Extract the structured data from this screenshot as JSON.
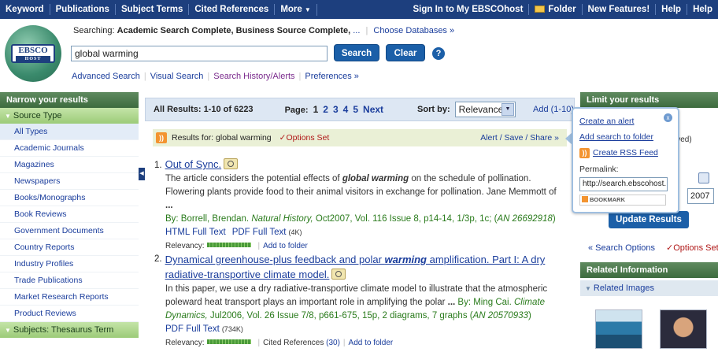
{
  "topnav": {
    "items": [
      "Keyword",
      "Publications",
      "Subject Terms",
      "Cited References",
      "More"
    ],
    "right_items": [
      "Sign In to My EBSCOhost",
      "Folder",
      "New Features!",
      "Help",
      "Help"
    ]
  },
  "logo": {
    "line1": "EBSCO",
    "line2": "HOST"
  },
  "header": {
    "searching_label": "Searching:",
    "databases": "Academic Search Complete, Business Source Complete,",
    "more_link": "...",
    "choose_db": "Choose Databases »",
    "search_value": "global warming",
    "search_btn": "Search",
    "clear_btn": "Clear",
    "help_icon": "?",
    "links": {
      "advanced": "Advanced Search",
      "visual": "Visual Search",
      "history": "Search History/Alerts",
      "prefs": "Preferences »"
    }
  },
  "left": {
    "title": "Narrow your results",
    "source_type": "Source Type",
    "items": [
      "All Types",
      "Academic Journals",
      "Magazines",
      "Newspapers",
      "Books/Monographs",
      "Book Reviews",
      "Government Documents",
      "Country Reports",
      "Industry Profiles",
      "Trade Publications",
      "Market Research Reports",
      "Product Reviews"
    ],
    "subjects": "Subjects: Thesaurus Term"
  },
  "results_bar": {
    "summary": "All Results: 1-10 of 6223",
    "page_label": "Page:",
    "pages": [
      "1",
      "2",
      "3",
      "4",
      "5"
    ],
    "next": "Next",
    "sort_label": "Sort by:",
    "sort_value": "Relevance",
    "add": "Add (1-10)"
  },
  "rss_bar": {
    "results_for": "Results for: global warming",
    "options_set": "✓Options Set",
    "alert": "Alert / Save / Share »"
  },
  "results": [
    {
      "num": "1.",
      "title": "Out of Sync.",
      "abstract_pre": "The article considers the potential effects of ",
      "abstract_em": "global warming",
      "abstract_post": " on the schedule of pollination. Flowering plants provide food to their animal visitors in exchange for pollination. Jane Memmott of ",
      "abstract_more": "...",
      "by": "By: Borrell, Brendan. ",
      "journal": "Natural History,",
      "citation": " Oct2007, Vol. 116 Issue 8, p14-14, 1/3p, 1c; (",
      "an": "AN 26692918",
      "html": "HTML Full Text",
      "pdf": "PDF Full Text",
      "pdf_size": "(4K)",
      "relevancy": "Relevancy:",
      "add_folder": "Add to folder"
    },
    {
      "num": "2.",
      "title_pre": "Dynamical greenhouse-plus feedback and polar ",
      "title_em": "warming",
      "title_post": " amplification. Part I: A dry radiative-transportive climate model.",
      "abstract": "In this paper, we use a dry radiative-transportive climate model to illustrate that the atmospheric poleward heat transport plays an important role in amplifying the polar ",
      "abstract_more": "...",
      "by": " By: Ming Cai. ",
      "journal": "Climate Dynamics,",
      "citation": " Jul2006, Vol. 26 Issue 7/8, p661-675, 15p, 2 diagrams, 7 graphs (",
      "an": "AN 20570933",
      "pdf": "PDF Full Text",
      "pdf_size": "(734K)",
      "relevancy": "Relevancy:",
      "cited": "Cited References",
      "cited_count": "(30)",
      "add_folder": "Add to folder"
    }
  ],
  "right": {
    "title": "Limit your results",
    "wed": "wed)",
    "date_value": "2007",
    "update_btn": "Update Results",
    "search_options": "« Search Options",
    "options_set": "✓Options Set",
    "related_info": "Related Information",
    "related_images": "Related Images"
  },
  "popup": {
    "create_alert": "Create an alert",
    "add_search": "Add search to folder",
    "rss": "Create RSS Feed",
    "permalink_label": "Permalink:",
    "permalink_value": "http://search.ebscohost.",
    "bookmark": "BOOKMARK",
    "close": "x"
  }
}
